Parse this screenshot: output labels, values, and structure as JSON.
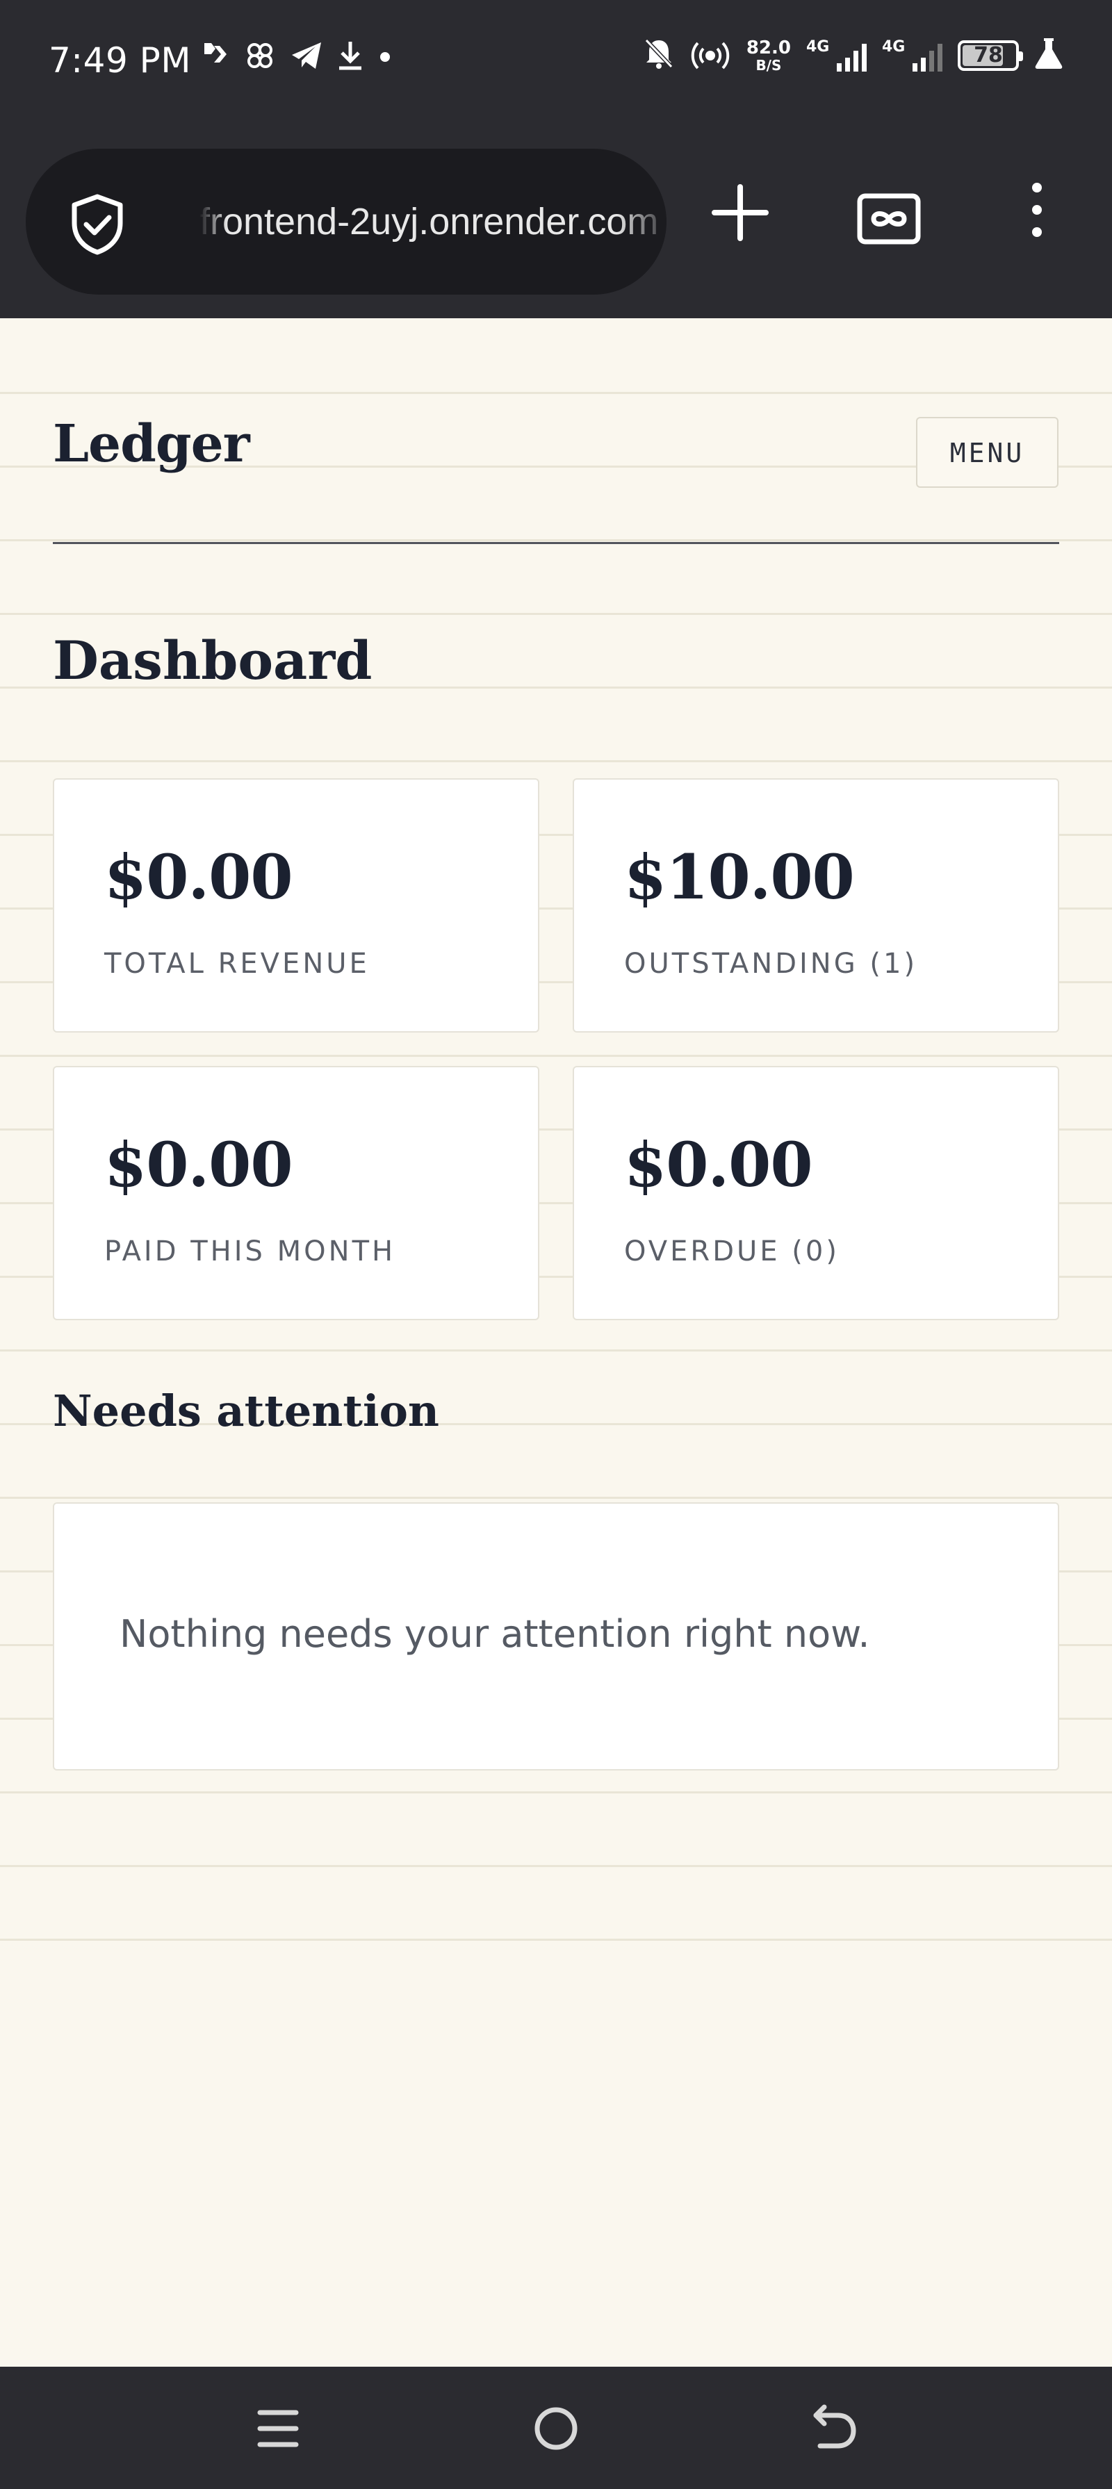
{
  "status_bar": {
    "time": "7:49 PM",
    "net_speed_value": "82.0",
    "net_speed_unit": "B/S",
    "signal_1_label": "4G",
    "signal_2_label": "4G",
    "battery_level": "78",
    "icons": [
      "blinkit-icon",
      "pinwheel-icon",
      "telegram-icon",
      "download-icon",
      "dot-icon",
      "mute-bell-icon",
      "hotspot-icon",
      "signal-icon",
      "battery-icon",
      "flask-icon"
    ]
  },
  "browser": {
    "url": "frontend-2uyj.onrender.com",
    "icons": [
      "shield-check-icon",
      "new-tab-icon",
      "incognito-tabs-icon",
      "more-vert-icon"
    ]
  },
  "header": {
    "brand": "Ledger",
    "menu_label": "MENU"
  },
  "main": {
    "title": "Dashboard",
    "stats": [
      {
        "value": "$0.00",
        "label": "TOTAL REVENUE"
      },
      {
        "value": "$10.00",
        "label": "OUTSTANDING (1)"
      },
      {
        "value": "$0.00",
        "label": "PAID THIS MONTH"
      },
      {
        "value": "$0.00",
        "label": "OVERDUE (0)"
      }
    ],
    "attention": {
      "title": "Needs attention",
      "empty_message": "Nothing needs your attention right now."
    }
  },
  "nav_bar": {
    "icons": [
      "recents-icon",
      "home-icon",
      "back-icon"
    ]
  },
  "colors": {
    "chrome_dark": "#2b2b30",
    "page_background": "#faf7ee",
    "ink": "#1b2130",
    "muted": "#5b5f68"
  }
}
